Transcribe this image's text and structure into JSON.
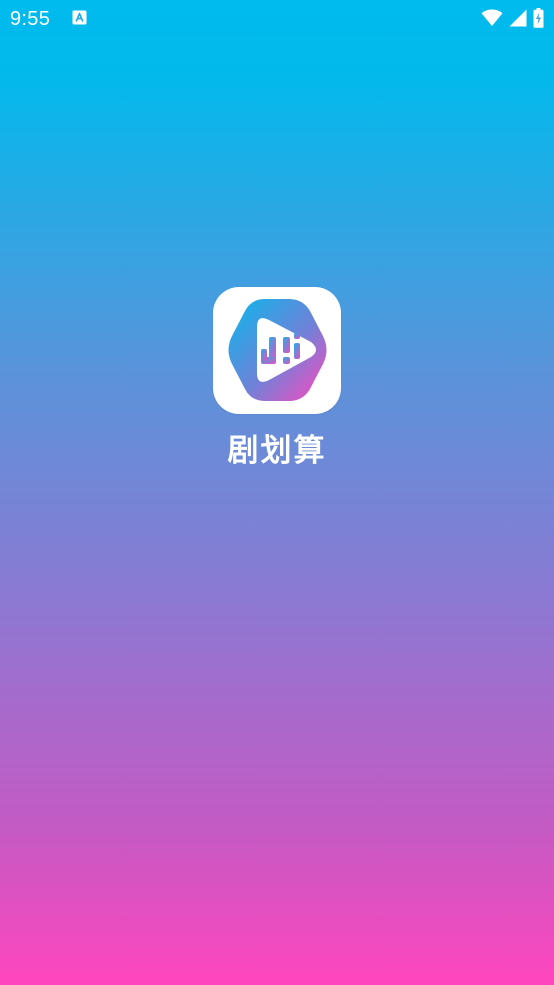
{
  "status_bar": {
    "time": "9:55",
    "notification_icon": "keyboard-a-icon",
    "wifi_icon": "wifi-icon",
    "signal_icon": "cell-signal-icon",
    "battery_icon": "battery-charging-icon"
  },
  "splash": {
    "app_icon": "play-logo-icon",
    "app_name": "剧划算"
  },
  "colors": {
    "gradient_top": "#00BBED",
    "gradient_bottom": "#FF46BE",
    "text": "#FFFFFF"
  }
}
